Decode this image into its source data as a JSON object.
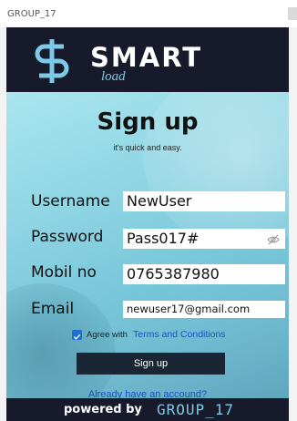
{
  "window": {
    "title": "GROUP_17"
  },
  "header": {
    "brand": "SMART",
    "brand_sub": "load"
  },
  "form": {
    "heading": "Sign up",
    "subheading": "it's quick and easy.",
    "fields": [
      {
        "label": "Username",
        "value": "NewUser"
      },
      {
        "label": "Password",
        "value": "Pass017#"
      },
      {
        "label": "Mobil no",
        "value": "0765387980"
      },
      {
        "label": "Email",
        "value": "newuser17@gmail.com"
      }
    ],
    "agree_prefix": "Agree with",
    "agree_link": "Terms and Conditions",
    "agree_checked": true,
    "signup_label": "Sign up",
    "already_link": "Already have an accound?"
  },
  "footer": {
    "powered": "powered by",
    "group": "GROUP_17"
  },
  "colors": {
    "header_bg": "#171a2a",
    "accent": "#7ec9e8",
    "button_bg": "#1a2634",
    "link": "#1a4fc9",
    "checkbox": "#1f6fd1"
  },
  "icons": {
    "logo": "dollar-s-logo-icon",
    "password_toggle": "eye-slash-icon",
    "checkbox": "checkmark-icon"
  }
}
